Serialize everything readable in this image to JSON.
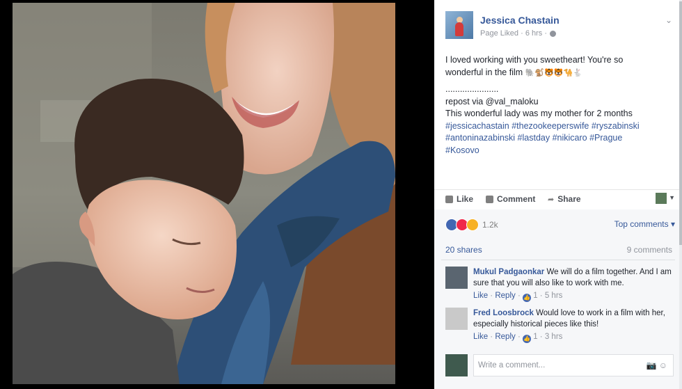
{
  "post": {
    "author": "Jessica Chastain",
    "meta_prefix": "Page Liked · 6 hrs ·",
    "text_lines": [
      "I loved working with you sweetheart! You're so",
      "wonderful in the film",
      "......................",
      "repost via @val_maloku",
      "This wonderful lady was my mother for 2 months"
    ],
    "emojis": "🐘🐒🐯🐯🐪🐇",
    "hashtag_lines": [
      "#jessicachastain #thezookeeperswife #ryszabinski",
      "#antoninazabinski #lastday #nikicaro #Prague",
      "#Kosovo"
    ],
    "actions": {
      "like": "Like",
      "comment": "Comment",
      "share": "Share"
    }
  },
  "stats": {
    "reaction_count": "1.2k",
    "top_comments": "Top comments ▾",
    "shares": "20 shares",
    "comments": "9 comments"
  },
  "comments": [
    {
      "name": "Mukul Padgaonkar",
      "text_line1": "We will do a film together. And",
      "text_line2": "I am sure that you will also like to work with me.",
      "like": "Like",
      "reply": "Reply",
      "likes": "1",
      "time": "5 hrs"
    },
    {
      "name": "Fred Loosbrock",
      "text_line1": "Would love to work in a film with",
      "text_line2": "her, especially historical pieces like this!",
      "like": "Like",
      "reply": "Reply",
      "likes": "1",
      "time": "3 hrs"
    }
  ],
  "write_comment_placeholder": "Write a comment...",
  "colors": {
    "link": "#365899",
    "text": "#1d2129",
    "muted": "#90949c",
    "accent": "#4267b2"
  }
}
